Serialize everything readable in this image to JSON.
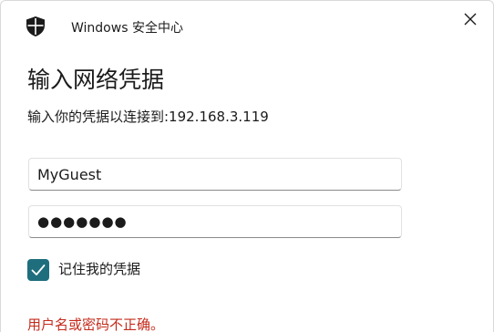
{
  "window": {
    "app_title": "Windows 安全中心",
    "icon": "shield-icon",
    "close_icon": "close-icon"
  },
  "dialog": {
    "heading": "输入网络凭据",
    "subtext": "输入你的凭据以连接到:192.168.3.119"
  },
  "form": {
    "username_value": "MyGuest",
    "password_value": "●●●●●●●",
    "remember_label": "记住我的凭据",
    "remember_checked": true
  },
  "error": {
    "message": "用户名或密码不正确。"
  },
  "colors": {
    "accent": "#1f6e7e",
    "error": "#c42b1c"
  }
}
